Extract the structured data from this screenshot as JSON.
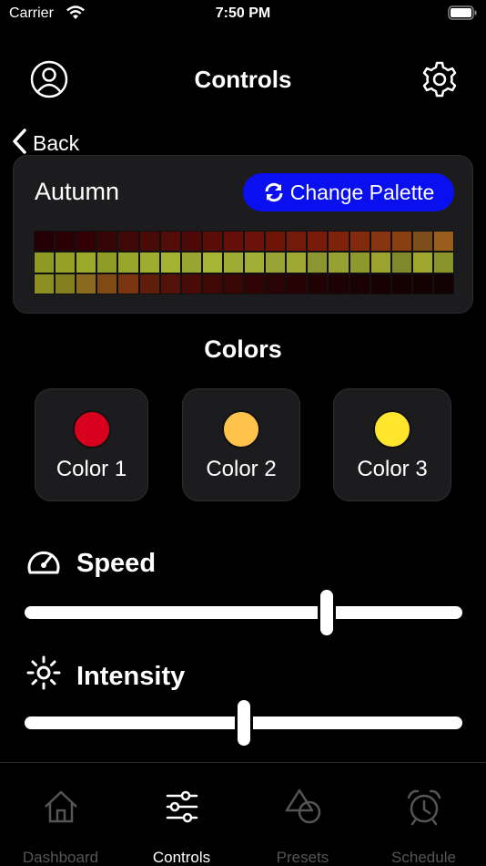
{
  "status_bar": {
    "carrier": "Carrier",
    "time": "7:50 PM"
  },
  "header": {
    "title": "Controls"
  },
  "back": {
    "label": "Back"
  },
  "palette": {
    "name": "Autumn",
    "change_label": "Change Palette",
    "rows": [
      [
        "#230003",
        "#2b0004",
        "#330005",
        "#380506",
        "#3e0808",
        "#4a0b08",
        "#520c0a",
        "#4c0906",
        "#5a0d07",
        "#650f08",
        "#6b1308",
        "#6e1508",
        "#731a0a",
        "#7a1b09",
        "#7e220b",
        "#822b0c",
        "#873510",
        "#8a3f12",
        "#7d4d1a",
        "#9a5e1c"
      ],
      [
        "#8f9a22",
        "#95a024",
        "#9ca827",
        "#8f9c26",
        "#9aa62b",
        "#a0ac2e",
        "#a5b232",
        "#9aa531",
        "#a8b436",
        "#9fac33",
        "#a2ae35",
        "#97a333",
        "#9ea833",
        "#8c9630",
        "#96a131",
        "#8e982d",
        "#9ba32e",
        "#7f892a",
        "#a0a52d",
        "#8a922a"
      ],
      [
        "#8c8f22",
        "#837f1f",
        "#8a6a1f",
        "#7f4a16",
        "#7a3412",
        "#5f1d0b",
        "#521109",
        "#480b06",
        "#3f0805",
        "#380705",
        "#300405",
        "#2a0304",
        "#260204",
        "#210203",
        "#1d0203",
        "#1a0203",
        "#170102",
        "#160102",
        "#140102",
        "#120102"
      ]
    ]
  },
  "colors": {
    "heading": "Colors",
    "items": [
      {
        "label": "Color 1",
        "swatch": "#d8001e"
      },
      {
        "label": "Color 2",
        "swatch": "#ffc24a"
      },
      {
        "label": "Color 3",
        "swatch": "#ffe52c"
      }
    ]
  },
  "speed": {
    "label": "Speed",
    "value": 0.69
  },
  "intensity": {
    "label": "Intensity",
    "value": 0.5
  },
  "tabs": [
    {
      "label": "Dashboard",
      "icon": "house-icon",
      "active": false
    },
    {
      "label": "Controls",
      "icon": "sliders-icon",
      "active": true
    },
    {
      "label": "Presets",
      "icon": "shapes-icon",
      "active": false
    },
    {
      "label": "Schedule",
      "icon": "alarm-clock-icon",
      "active": false
    }
  ],
  "accent_color": "#0a0ff0"
}
